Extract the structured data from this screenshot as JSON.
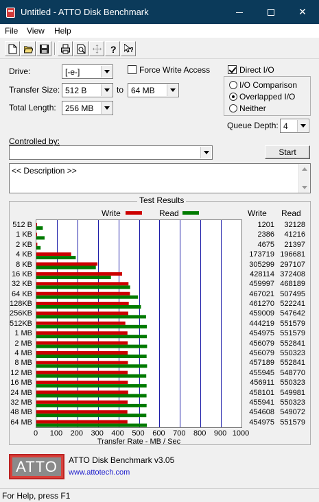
{
  "window": {
    "title": "Untitled - ATTO Disk Benchmark",
    "minimize": "─",
    "maximize": "☐",
    "close": "✕"
  },
  "menu": [
    "File",
    "View",
    "Help"
  ],
  "toolbar": {
    "icons": [
      "new-icon",
      "open-icon",
      "save-icon",
      "print-icon",
      "print-preview-icon",
      "move-icon",
      "help-icon",
      "context-help-icon"
    ]
  },
  "form": {
    "drive_label": "Drive:",
    "drive_value": "[-e-]",
    "force_write_label": "Force Write Access",
    "force_write_checked": false,
    "direct_io_label": "Direct I/O",
    "direct_io_checked": true,
    "transfer_size_label": "Transfer Size:",
    "transfer_from": "512 B",
    "to_label": "to",
    "transfer_to": "64 MB",
    "total_length_label": "Total Length:",
    "total_length": "256 MB",
    "io_comparison_label": "I/O Comparison",
    "overlapped_io_label": "Overlapped I/O",
    "neither_label": "Neither",
    "selected_io_mode": "Overlapped I/O",
    "queue_depth_label": "Queue Depth:",
    "queue_depth": "4",
    "controlled_by_label": "Controlled by:",
    "controlled_by_value": "",
    "start_label": "Start",
    "description": "<< Description >>"
  },
  "results": {
    "title": "Test Results",
    "legend_write": "Write",
    "legend_read": "Read",
    "col_write": "Write",
    "col_read": "Read",
    "xlabel": "Transfer Rate - MB / Sec",
    "write_color": "#cc0000",
    "read_color": "#007a00",
    "grid_color": "#1c1ca8"
  },
  "chart_data": {
    "type": "bar",
    "orientation": "horizontal",
    "xlabel": "Transfer Rate - MB / Sec",
    "xlim": [
      0,
      1000
    ],
    "xticks": [
      "0",
      "100",
      "200",
      "300",
      "400",
      "500",
      "600",
      "700",
      "800",
      "900",
      "1000"
    ],
    "categories": [
      "512 B",
      "1 KB",
      "2 KB",
      "4 KB",
      "8 KB",
      "16 KB",
      "32 KB",
      "64 KB",
      "128KB",
      "256KB",
      "512KB",
      "1 MB",
      "2 MB",
      "4 MB",
      "8 MB",
      "12 MB",
      "16 MB",
      "24 MB",
      "32 MB",
      "48 MB",
      "64 MB"
    ],
    "write_labels": [
      "1201",
      "2386",
      "4675",
      "173719",
      "305299",
      "428114",
      "459997",
      "467021",
      "461270",
      "459009",
      "444219",
      "454975",
      "456079",
      "456079",
      "457189",
      "455945",
      "456911",
      "458101",
      "455941",
      "454608",
      "454975"
    ],
    "read_labels": [
      "32128",
      "41216",
      "21397",
      "196681",
      "297107",
      "372408",
      "468189",
      "507495",
      "522241",
      "547642",
      "551579",
      "551579",
      "552841",
      "550323",
      "552841",
      "548770",
      "550323",
      "549981",
      "550323",
      "549072",
      "551579"
    ],
    "series": [
      {
        "name": "Write",
        "values": [
          1.2,
          2.3,
          4.6,
          169.6,
          298.1,
          418.1,
          449.2,
          456.1,
          450.5,
          448.2,
          433.8,
          444.3,
          445.4,
          445.4,
          446.5,
          445.3,
          446.2,
          447.4,
          445.3,
          443.9,
          444.3
        ]
      },
      {
        "name": "Read",
        "values": [
          31.4,
          40.3,
          20.9,
          192.1,
          290.1,
          363.7,
          457.2,
          495.6,
          510.0,
          534.8,
          538.6,
          538.6,
          539.9,
          537.4,
          539.9,
          535.9,
          537.4,
          537.1,
          537.4,
          536.2,
          538.6
        ]
      }
    ]
  },
  "footer": {
    "logo": "ATTO",
    "app_version": "ATTO Disk Benchmark v3.05",
    "website": "www.attotech.com"
  },
  "status": "For Help, press F1"
}
